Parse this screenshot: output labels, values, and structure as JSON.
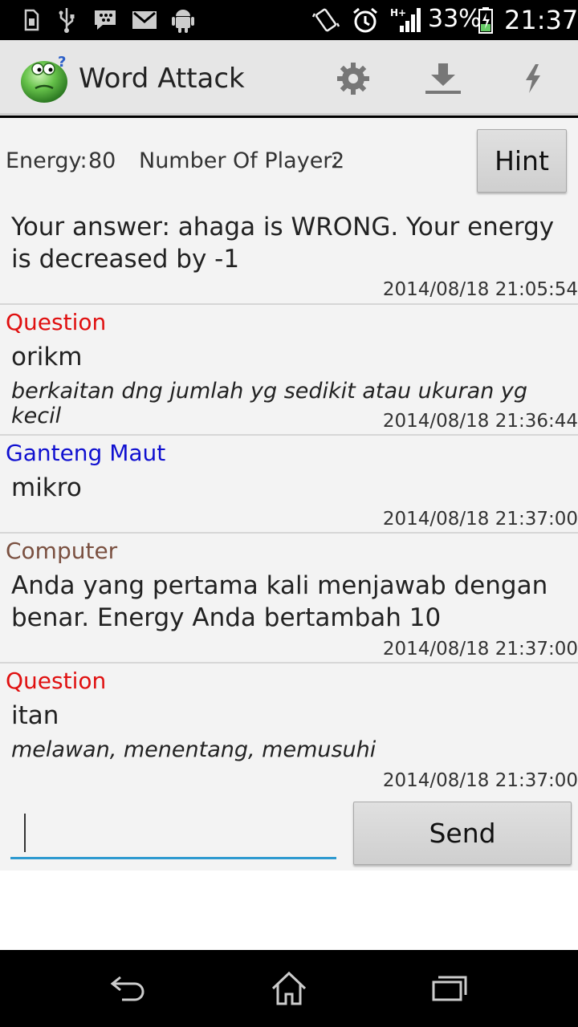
{
  "status_bar": {
    "battery": "33%",
    "time": "21:37",
    "network": "H+"
  },
  "app": {
    "title": "Word Attack"
  },
  "info": {
    "energy_label": "Energy:",
    "energy_value": "80",
    "players_label": "Number Of Player:",
    "players_value": "2",
    "hint_label": "Hint"
  },
  "messages": [
    {
      "sender": "",
      "text": "Your answer: ahaga is WRONG. Your energy is decreased by -1",
      "clue": "",
      "timestamp": "2014/08/18 21:05:54"
    },
    {
      "sender": "Question",
      "sender_color": "#e01010",
      "text": "orikm",
      "clue": "berkaitan dng jumlah yg sedikit atau ukuran yg kecil",
      "timestamp": "2014/08/18 21:36:44"
    },
    {
      "sender": "Ganteng Maut",
      "sender_color": "#1010d0",
      "text": "mikro",
      "clue": "",
      "timestamp": "2014/08/18 21:37:00"
    },
    {
      "sender": "Computer",
      "sender_color": "#7a5040",
      "text": "Anda yang pertama kali menjawab dengan benar. Energy Anda bertambah 10",
      "clue": "",
      "timestamp": "2014/08/18 21:37:00"
    },
    {
      "sender": "Question",
      "sender_color": "#e01010",
      "text": "itan",
      "clue": "melawan, menentang, memusuhi",
      "timestamp": "2014/08/18 21:37:00"
    }
  ],
  "composer": {
    "input_value": "",
    "send_label": "Send"
  },
  "colors": {
    "accent": "#2e9ad0",
    "question": "#e01010",
    "player": "#1010d0",
    "computer": "#7a5040"
  }
}
